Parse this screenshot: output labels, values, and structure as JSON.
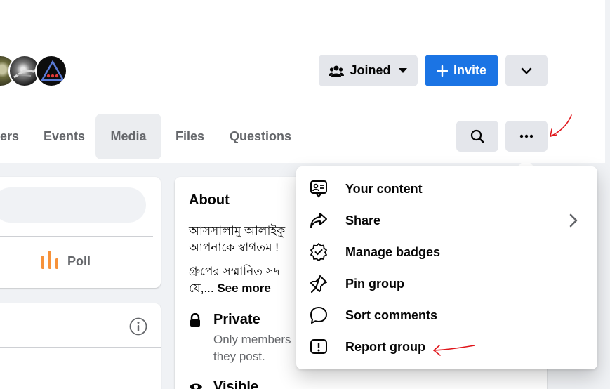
{
  "header": {
    "joined_label": "Joined",
    "invite_label": "Invite"
  },
  "tabs": [
    {
      "label": "ers"
    },
    {
      "label": "Events"
    },
    {
      "label": "Media"
    },
    {
      "label": "Files"
    },
    {
      "label": "Questions"
    }
  ],
  "composer": {
    "poll_label": "Poll"
  },
  "about": {
    "title": "About",
    "line1": "আসসালামু আলাইকু",
    "line2": "আপনাকে স্বাগতম !",
    "line3": "গ্রুপের সম্মানিত সদ",
    "line4_prefix": "যে,...",
    "see_more": "See more",
    "private_title": "Private",
    "private_desc1": "Only members",
    "private_desc2": "they post.",
    "visible_title": "Visible"
  },
  "menu": {
    "items": [
      {
        "label": "Your content",
        "icon": "content-icon"
      },
      {
        "label": "Share",
        "icon": "share-icon"
      },
      {
        "label": "Manage badges",
        "icon": "badge-icon"
      },
      {
        "label": "Pin group",
        "icon": "pin-icon"
      },
      {
        "label": "Sort comments",
        "icon": "comment-icon"
      },
      {
        "label": "Report group",
        "icon": "report-icon"
      }
    ]
  },
  "colors": {
    "accent": "#1b74e4",
    "annotation": "#e0161b",
    "poll": "#f7923a"
  }
}
